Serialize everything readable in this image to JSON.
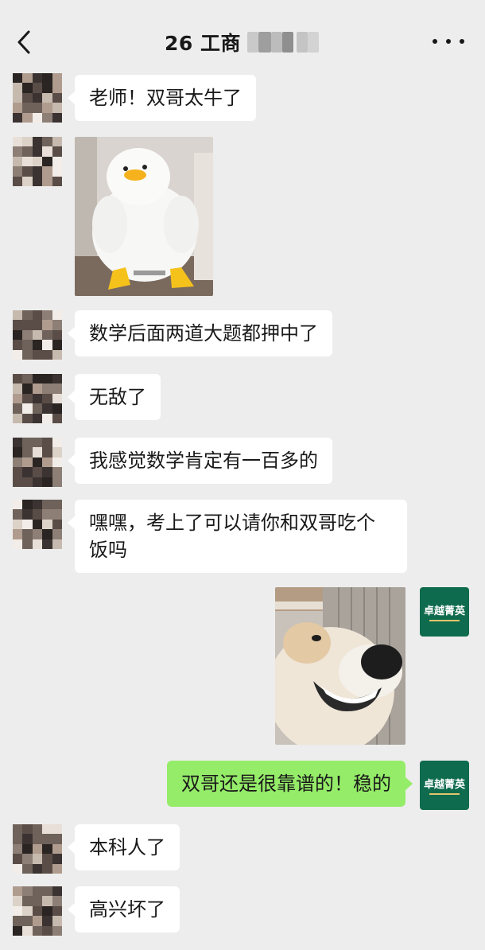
{
  "header": {
    "title": "26 工商",
    "back_icon": "chevron-left-icon",
    "more_icon": "more-dots-icon"
  },
  "colors": {
    "background": "#ededed",
    "bubble_incoming": "#ffffff",
    "bubble_outgoing": "#95ec69",
    "self_avatar": "#0f6b4d"
  },
  "self_avatar": {
    "logo_text": "卓越菁英"
  },
  "messages": [
    {
      "from": "other",
      "type": "text",
      "text": "老师！双哥太牛了"
    },
    {
      "from": "other",
      "type": "image",
      "image": "white-duck-plush-photo"
    },
    {
      "from": "other",
      "type": "text",
      "text": "数学后面两道大题都押中了"
    },
    {
      "from": "other",
      "type": "text",
      "text": "无敌了"
    },
    {
      "from": "other",
      "type": "text",
      "text": "我感觉数学肯定有一百多的"
    },
    {
      "from": "other",
      "type": "text",
      "text": "嘿嘿，考上了可以请你和双哥吃个饭吗"
    },
    {
      "from": "self",
      "type": "image",
      "image": "smiling-dog-photo"
    },
    {
      "from": "self",
      "type": "text",
      "text": "双哥还是很靠谱的！稳的"
    },
    {
      "from": "other",
      "type": "text",
      "text": "本科人了"
    },
    {
      "from": "other",
      "type": "text",
      "text": "高兴坏了"
    }
  ]
}
